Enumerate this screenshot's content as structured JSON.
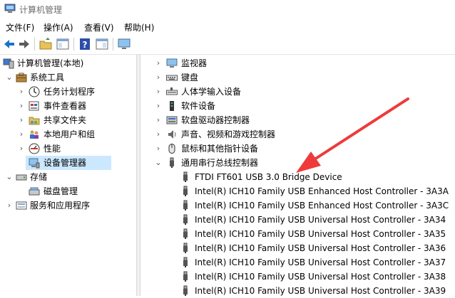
{
  "window": {
    "title": "计算机管理"
  },
  "menu": [
    "文件(F)",
    "操作(A)",
    "查看(V)",
    "帮助(H)"
  ],
  "toolbar": [
    "back-icon",
    "forward-icon",
    "up-folder-icon",
    "show-hide-tree-icon",
    "help-icon",
    "properties-icon",
    "monitor-icon"
  ],
  "tree": {
    "root": "计算机管理(本地)",
    "system_tools": "系统工具",
    "task_scheduler": "任务计划程序",
    "event_viewer": "事件查看器",
    "shared_folders": "共享文件夹",
    "local_users": "本地用户和组",
    "performance": "性能",
    "device_manager": "设备管理器",
    "storage": "存储",
    "disk_management": "磁盘管理",
    "services": "服务和应用程序"
  },
  "devices": {
    "categories": [
      "监视器",
      "键盘",
      "人体学输入设备",
      "软件设备",
      "软盘驱动器控制器",
      "声音、视频和游戏控制器",
      "鼠标和其他指针设备",
      "通用串行总线控制器"
    ],
    "usb_children": [
      "FTDI FT601 USB 3.0 Bridge Device",
      "Intel(R) ICH10 Family USB Enhanced Host Controller - 3A3A",
      "Intel(R) ICH10 Family USB Enhanced Host Controller - 3A3C",
      "Intel(R) ICH10 Family USB Universal Host Controller - 3A34",
      "Intel(R) ICH10 Family USB Universal Host Controller - 3A35",
      "Intel(R) ICH10 Family USB Universal Host Controller - 3A36",
      "Intel(R) ICH10 Family USB Universal Host Controller - 3A37",
      "Intel(R) ICH10 Family USB Universal Host Controller - 3A38",
      "Intel(R) ICH10 Family USB Universal Host Controller - 3A39"
    ]
  },
  "colors": {
    "selection": "#cce8ff",
    "arrow": "#ee3a3a"
  }
}
